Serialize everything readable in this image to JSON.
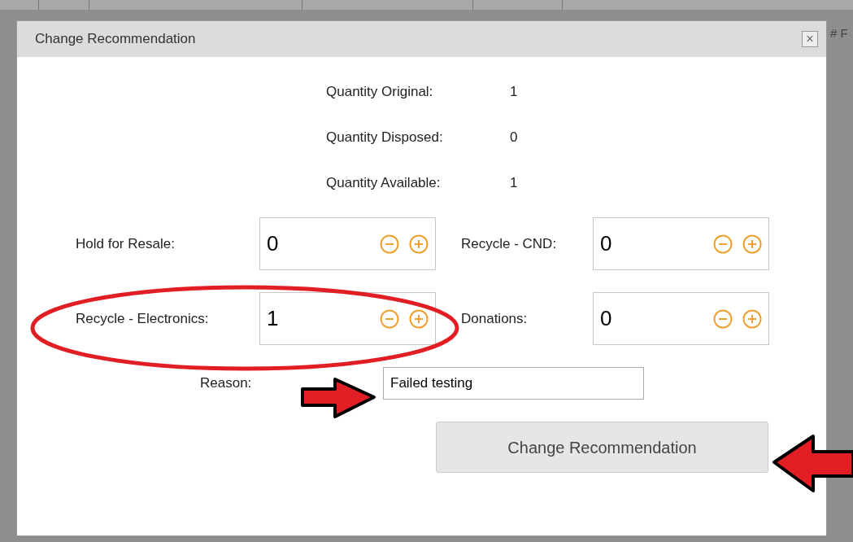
{
  "background": {
    "column_label": "# F"
  },
  "dialog": {
    "title": "Change Recommendation",
    "close": "×",
    "quantities": [
      {
        "label": "Quantity Original:",
        "value": "1"
      },
      {
        "label": "Quantity Disposed:",
        "value": "0"
      },
      {
        "label": "Quantity Available:",
        "value": "1"
      }
    ],
    "allocations": [
      [
        {
          "label": "Hold for Resale:",
          "value": "0"
        },
        {
          "label": "Recycle - CND:",
          "value": "0"
        }
      ],
      [
        {
          "label": "Recycle - Electronics:",
          "value": "1"
        },
        {
          "label": "Donations:",
          "value": "0"
        }
      ]
    ],
    "reason": {
      "label": "Reason:",
      "value": "Failed testing"
    },
    "submit": "Change Recommendation"
  }
}
